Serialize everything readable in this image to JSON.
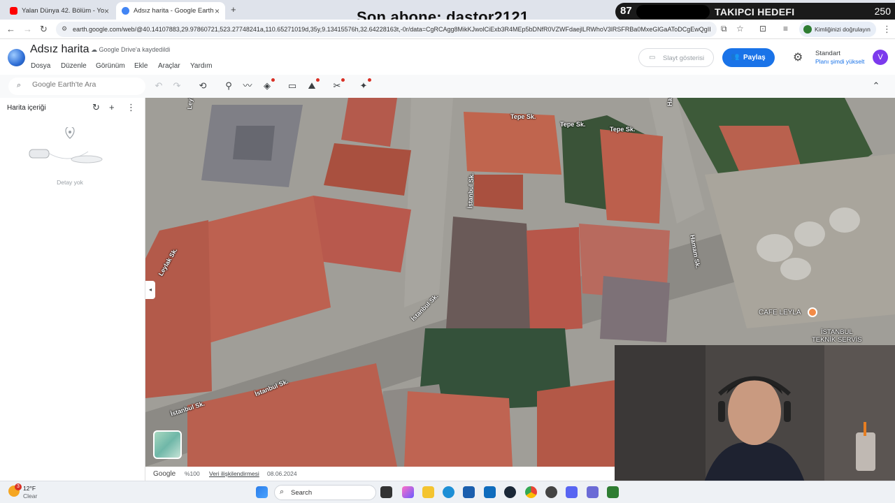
{
  "browser": {
    "tabs": [
      {
        "title": "Yalan Dünya 42. Bölüm - YouTu",
        "active": false
      },
      {
        "title": "Adsız harita - Google Earth",
        "active": true
      }
    ],
    "url": "earth.google.com/web/@40.14107883,29.97860721,523.27748241a,110.65271019d,35y,9.13415576h,32.64228163t,-0r/data=CgRCAgg8MikKJwolCiExb3R4MEp5bDNfR0VZWFdaejlLRWhoV3lRSFRBa0MxeGlGaAToDCgEwQgII",
    "verify_label": "Kimliğinizi doğrulayın"
  },
  "stream_overlay": {
    "last_subscriber": "Son abone: dastor2121",
    "follower_count": "87",
    "follower_goal_label": "TAKIPCI HEDEFI",
    "follower_goal_target": "250"
  },
  "earth": {
    "map_title": "Adsız harita",
    "save_status": "Google Drive'a kaydedildi",
    "menus": [
      "Dosya",
      "Düzenle",
      "Görünüm",
      "Ekle",
      "Araçlar",
      "Yardım"
    ],
    "slideshow_label": "Slayt gösterisi",
    "share_label": "Paylaş",
    "plan_name": "Standart",
    "plan_upgrade": "Planı şimdi yükselt",
    "avatar_letter": "V",
    "search_placeholder": "Google Earth'te Ara",
    "panel_title": "Harita içeriği",
    "panel_empty": "Detay yok"
  },
  "map": {
    "streets": [
      {
        "name": "Leylak Sk."
      },
      {
        "name": "Leylak Sk."
      },
      {
        "name": "Tepe Sk."
      },
      {
        "name": "Tepe Sk."
      },
      {
        "name": "Tepe Sk."
      },
      {
        "name": "İstanbul Sk."
      },
      {
        "name": "Hamam Sk."
      },
      {
        "name": "Hamam Sk."
      },
      {
        "name": "İstanbul Sk."
      },
      {
        "name": "İstanbul Sk."
      },
      {
        "name": "İstanbul Sk."
      }
    ],
    "poi_cafe": "CAFE LEYLA",
    "poi_service_line1": "İSTANBUL",
    "poi_service_line2": "TEKNİK SERVİS",
    "footer": {
      "brand": "Google",
      "zoom": "%100",
      "data_attribution": "Veri ilişkilendirmesi",
      "imagery_date": "08.06.2024"
    }
  },
  "taskbar": {
    "weather_temp": "12°F",
    "weather_desc": "Clear",
    "weather_badge": "3",
    "search_label": "Search"
  },
  "colors": {
    "share_blue": "#1a73e8",
    "roof_red": "#b8594d",
    "avatar_purple": "#7c3aed"
  }
}
